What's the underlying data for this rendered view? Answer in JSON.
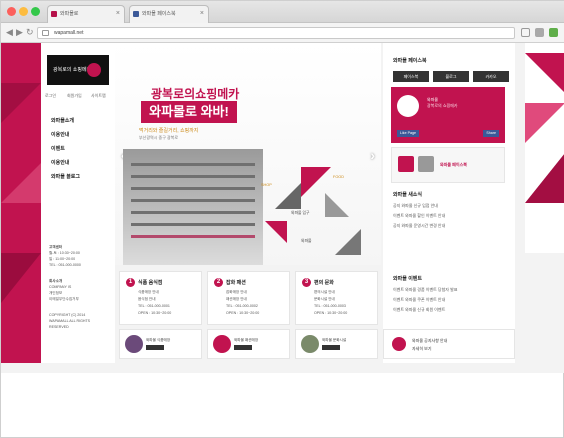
{
  "browser": {
    "tabs": [
      {
        "label": "와파몰로"
      },
      {
        "label": "와파몰 페이스북"
      }
    ],
    "url": "wapamall.net",
    "back_icon": "back-arrow-icon",
    "forward_icon": "forward-arrow-icon",
    "reload_icon": "reload-icon"
  },
  "colors": {
    "brand": "#c1134f",
    "accent": "#cc8a18",
    "dark": "#111111"
  },
  "site": {
    "logo": {
      "text": "광복로의 쇼핑메카",
      "mark": "와파"
    },
    "topnav": [
      "로그인",
      "회원가입",
      "사이트맵"
    ],
    "menu": [
      "와파몰소개",
      "이용안내",
      "이벤트",
      "이용안내",
      "와파몰 블로그"
    ],
    "contact": {
      "label": "고객센터",
      "lines": [
        "월-토 : 10:30~20:00",
        "일 : 11:00~20:00",
        "TEL : 051-000-0000"
      ]
    },
    "company": {
      "label": "회사소개",
      "lines": [
        "COMPANY IS",
        "개인정보",
        "이메일무단수집거부"
      ]
    },
    "copyright": [
      "COPYRIGHT (C) 2014",
      "WAPAMALL ALL RIGHTS",
      "RESERVED"
    ],
    "hero": {
      "headline": "광복로의쇼핑메카",
      "band": "와파몰로 와바!",
      "sub": "먹거리와 즐길거리, 쇼핑까지",
      "addr": "부산광역시 중구 광복로",
      "labels": [
        "SHOP",
        "FOOD",
        "와파몰 입구",
        "와파몰"
      ]
    },
    "right": {
      "title": "와파몰 페이스북",
      "buttons": [
        "페이스북",
        "블로그",
        "카카오"
      ],
      "fb": {
        "name": "와파몰",
        "sub": "광복로의 쇼핑메카",
        "like": "Like Page",
        "share": "Share"
      },
      "fb_note": "와파몰 페이스북",
      "news_title": "와파몰 새소식",
      "news": [
        "공지 와파몰 신규 입점 안내",
        "이벤트 와파몰 할인 이벤트 안내",
        "공지 와파몰 운영시간 변경 안내"
      ],
      "event_title": "와파몰 이벤트",
      "events": [
        "이벤트 와파몰 경품 이벤트 당첨자 발표",
        "이벤트 와파몰 쿠폰 이벤트 안내",
        "이벤트 와파몰 신규 회원 이벤트"
      ]
    },
    "cards": [
      {
        "num": "1",
        "title": "식품 음식점",
        "items": [
          "식품매장 안내",
          "음식점 안내",
          "TEL : 051-000-0001",
          "OPEN : 10:30~20:00"
        ]
      },
      {
        "num": "2",
        "title": "잡화 패션",
        "items": [
          "잡화매장 안내",
          "패션매장 안내",
          "TEL : 051-000-0002",
          "OPEN : 10:30~20:00"
        ]
      },
      {
        "num": "3",
        "title": "편의 문화",
        "items": [
          "편의시설 안내",
          "문화시설 안내",
          "TEL : 051-000-0003",
          "OPEN : 10:30~20:00"
        ]
      }
    ],
    "strips": [
      {
        "text": "와파몰 식품매장"
      },
      {
        "text": "와파몰 패션매장"
      },
      {
        "text": "와파몰 문화시설"
      }
    ],
    "notice": {
      "line1": "와파몰 공지사항 안내",
      "line2": "자세히 보기"
    }
  }
}
